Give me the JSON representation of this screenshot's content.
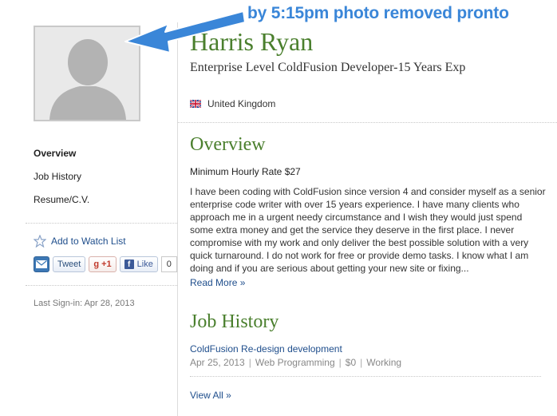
{
  "annotation": {
    "text": "by 5:15pm photo removed pronto"
  },
  "profile": {
    "name": "Harris Ryan",
    "title": "Enterprise Level ColdFusion Developer-15 Years Exp",
    "location": "United Kingdom",
    "flag_icon": "uk-flag-icon"
  },
  "sidebar": {
    "nav": [
      {
        "label": "Overview",
        "active": true
      },
      {
        "label": "Job History",
        "active": false
      },
      {
        "label": "Resume/C.V.",
        "active": false
      }
    ],
    "watch_label": "Add to Watch List",
    "social": {
      "tweet_label": "Tweet",
      "gplus_label": "+1",
      "like_label": "Like",
      "like_count": "0"
    },
    "last_signin": "Last Sign-in: Apr 28, 2013"
  },
  "overview": {
    "heading": "Overview",
    "rate": "Minimum Hourly Rate $27",
    "description": "I have been coding with ColdFusion since version 4 and consider myself as a senior enterprise code writer with over 15 years experience. I have many clients who approach me in a urgent needy circumstance and I wish they would just spend some extra money and get the service they deserve in the first place. I never compromise with my work and only deliver the best possible solution with a very quick turnaround. I do not work for free or provide demo tasks. I know what I am doing and if you are serious about getting your new site or fixing...",
    "read_more": "Read More »"
  },
  "job_history": {
    "heading": "Job History",
    "jobs": [
      {
        "title": "ColdFusion Re-design development",
        "date": "Apr 25, 2013",
        "category": "Web Programming",
        "amount": "$0",
        "status": "Working"
      }
    ],
    "view_all": "View All »"
  },
  "colors": {
    "accent_green": "#4a7f2d",
    "link_blue": "#1f4e8c",
    "annotation_blue": "#3a86d8"
  }
}
